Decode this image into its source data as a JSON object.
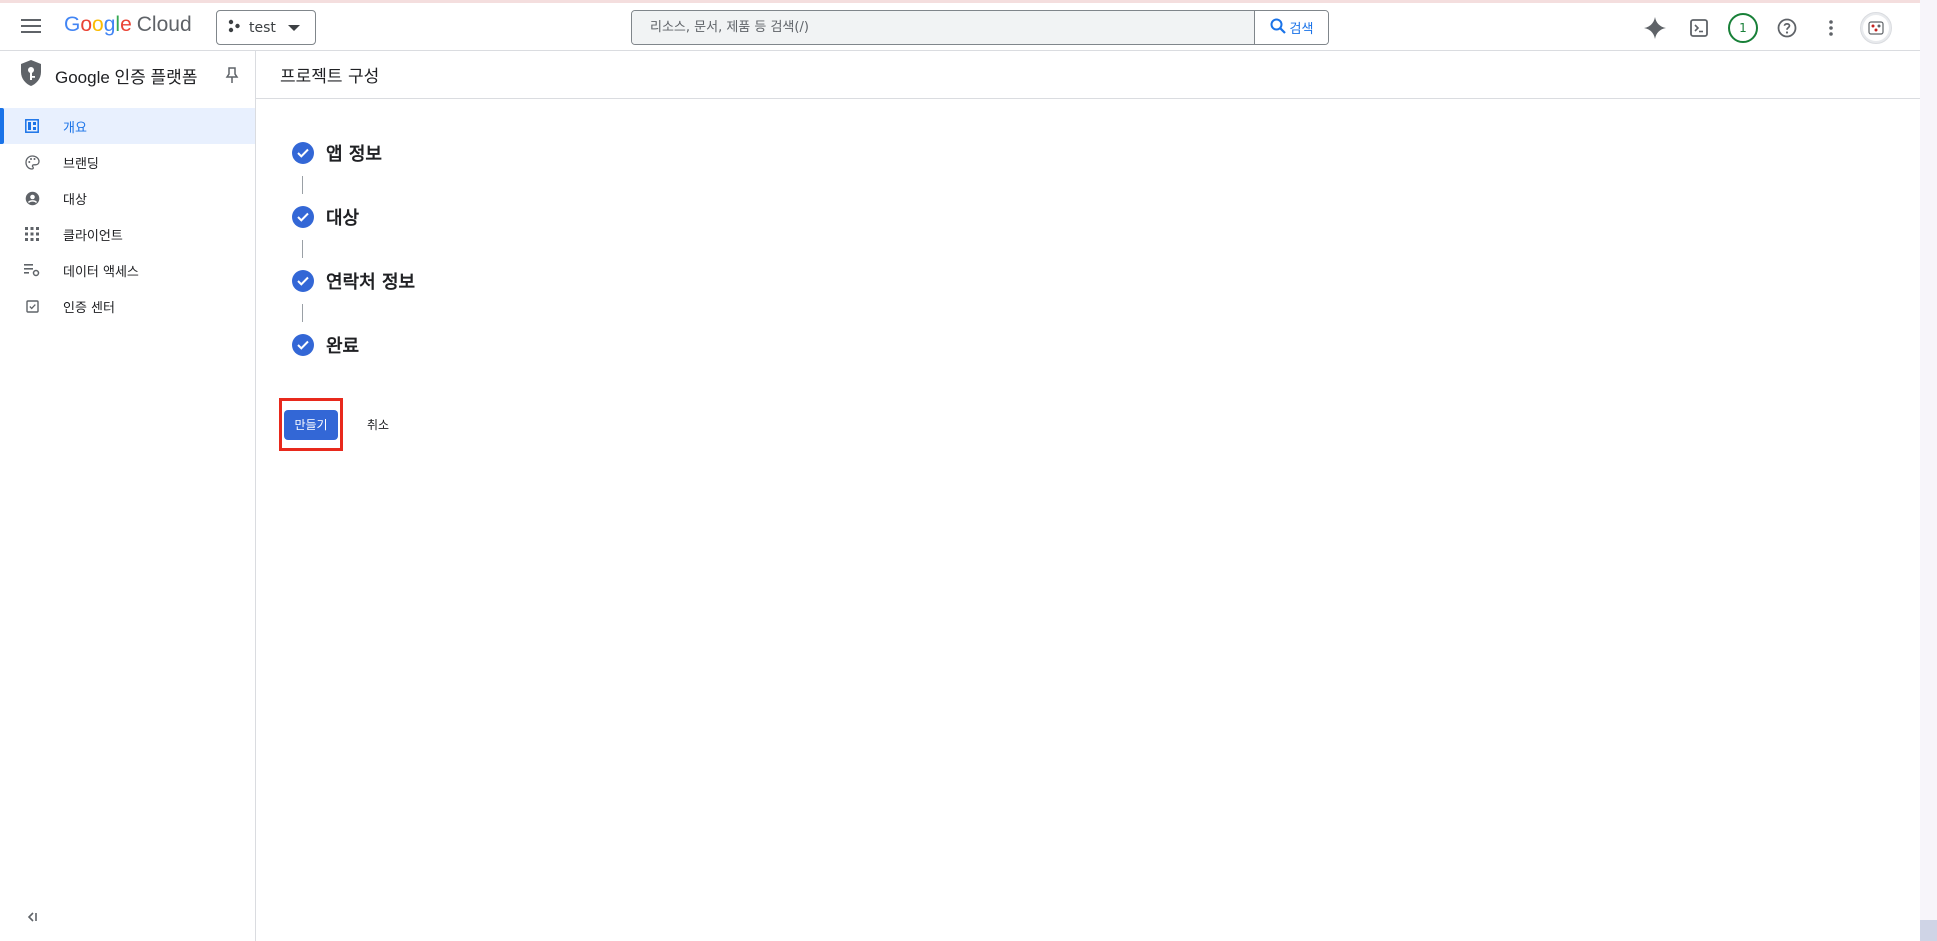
{
  "topbar": {
    "logo_google": "Google",
    "logo_cloud": "Cloud",
    "project_name": "test",
    "search_placeholder": "리소스, 문서, 제품 등 검색(/)",
    "search_button": "검색",
    "notification_count": "1"
  },
  "sidebar": {
    "product_title": "Google 인증 플랫폼",
    "items": [
      {
        "label": "개요",
        "icon": "dashboard-icon",
        "active": true
      },
      {
        "label": "브랜딩",
        "icon": "palette-icon",
        "active": false
      },
      {
        "label": "대상",
        "icon": "account-circle-icon",
        "active": false
      },
      {
        "label": "클라이언트",
        "icon": "apps-grid-icon",
        "active": false
      },
      {
        "label": "데이터 액세스",
        "icon": "list-settings-icon",
        "active": false
      },
      {
        "label": "인증 센터",
        "icon": "verified-checkbox-icon",
        "active": false
      }
    ]
  },
  "main": {
    "page_title": "프로젝트 구성",
    "steps": [
      {
        "label": "앱 정보",
        "status": "complete"
      },
      {
        "label": "대상",
        "status": "complete"
      },
      {
        "label": "연락처 정보",
        "status": "complete"
      },
      {
        "label": "완료",
        "status": "complete"
      }
    ],
    "create_button": "만들기",
    "cancel_button": "취소"
  },
  "colors": {
    "accent": "#1a73e8",
    "primary_button": "#3367d6",
    "highlight_box": "#e8291c",
    "active_nav_bg": "#e8f0fe"
  }
}
